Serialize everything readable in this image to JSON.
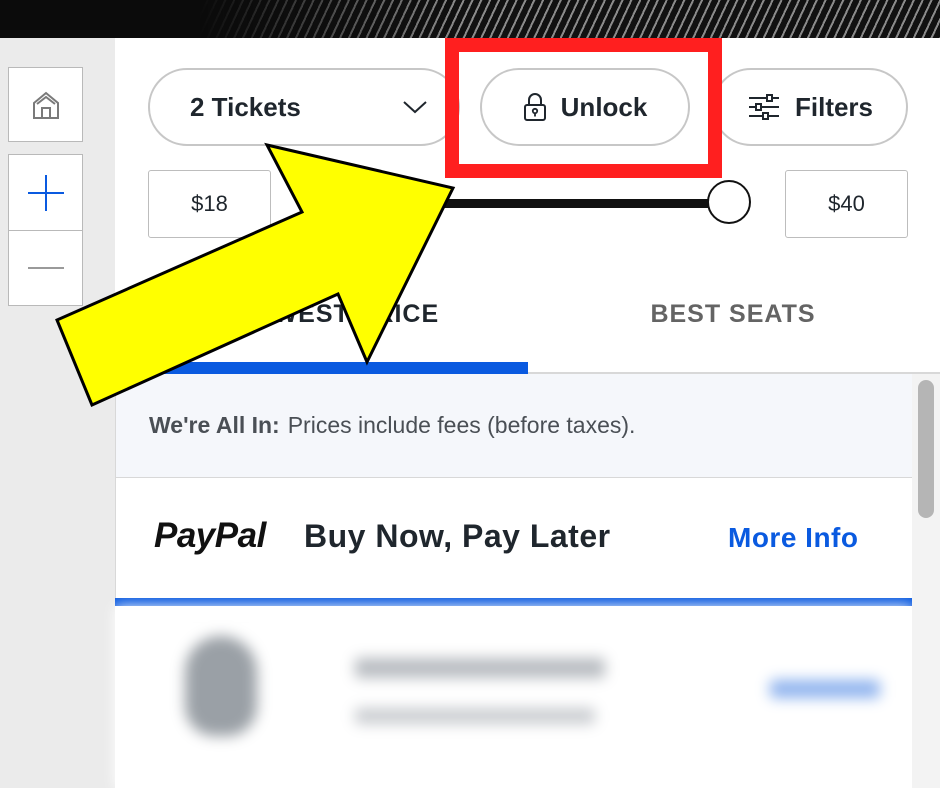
{
  "ticket_selector": {
    "label": "2 Tickets"
  },
  "unlock_button": {
    "label": "Unlock"
  },
  "filters_button": {
    "label": "Filters"
  },
  "price_range": {
    "min_label": "$18",
    "max_label": "$40"
  },
  "tabs": [
    {
      "label": "LOWEST PRICE",
      "selected": true
    },
    {
      "label": "BEST SEATS",
      "selected": false
    }
  ],
  "notice": {
    "bold": "We're All In:",
    "text": "Prices include fees (before taxes)."
  },
  "paypal": {
    "logo": "PayPal",
    "text": "Buy Now, Pay Later",
    "link": "More Info"
  },
  "colors": {
    "accent_blue": "#0a5ae0",
    "highlight_red": "#ff1f1f",
    "arrow_yellow": "#ffff00"
  },
  "icons": {
    "home": "home-icon",
    "zoom_in": "plus-icon",
    "zoom_out": "minus-icon",
    "chevron": "chevron-down-icon",
    "lock": "lock-icon",
    "filters": "sliders-icon"
  }
}
